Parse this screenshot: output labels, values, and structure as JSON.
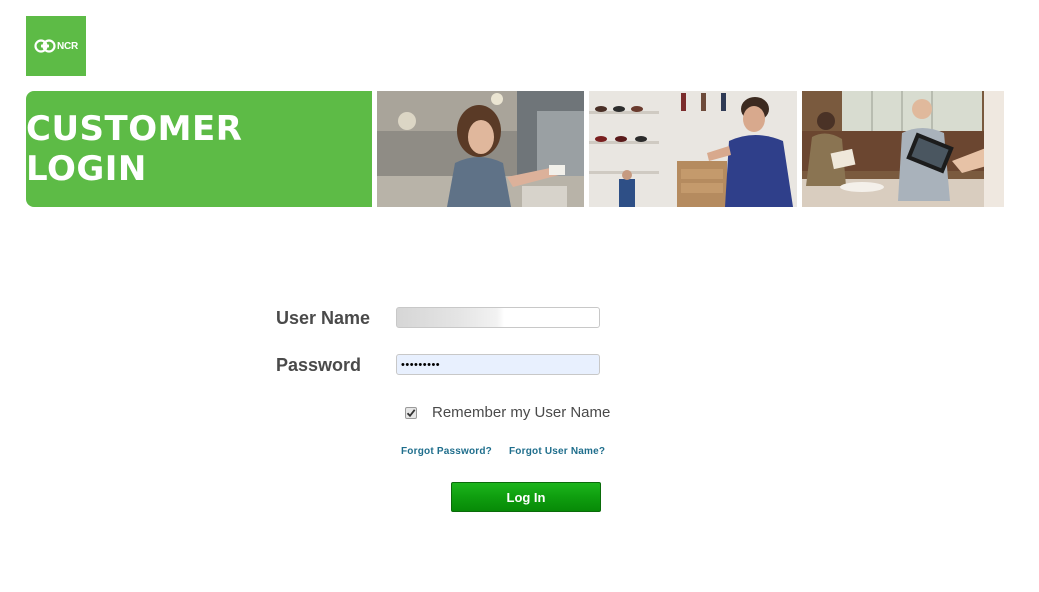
{
  "logo": {
    "text": "NCR",
    "color": "#5dbb46"
  },
  "banner": {
    "title": "CUSTOMER LOGIN",
    "accent_color": "#5dbb46"
  },
  "form": {
    "username_label": "User Name",
    "username_value": "",
    "password_label": "Password",
    "password_value": "•••••••••",
    "remember_label": "Remember my User Name",
    "remember_checked": true,
    "forgot_password": "Forgot Password?",
    "forgot_username": "Forgot User Name?",
    "login_button": "Log In",
    "button_color": "#0f9e0f",
    "link_color": "#1f6e8c"
  },
  "icons": {
    "logo": "ncr-logo-icon",
    "checkbox": "checkmark-icon"
  }
}
